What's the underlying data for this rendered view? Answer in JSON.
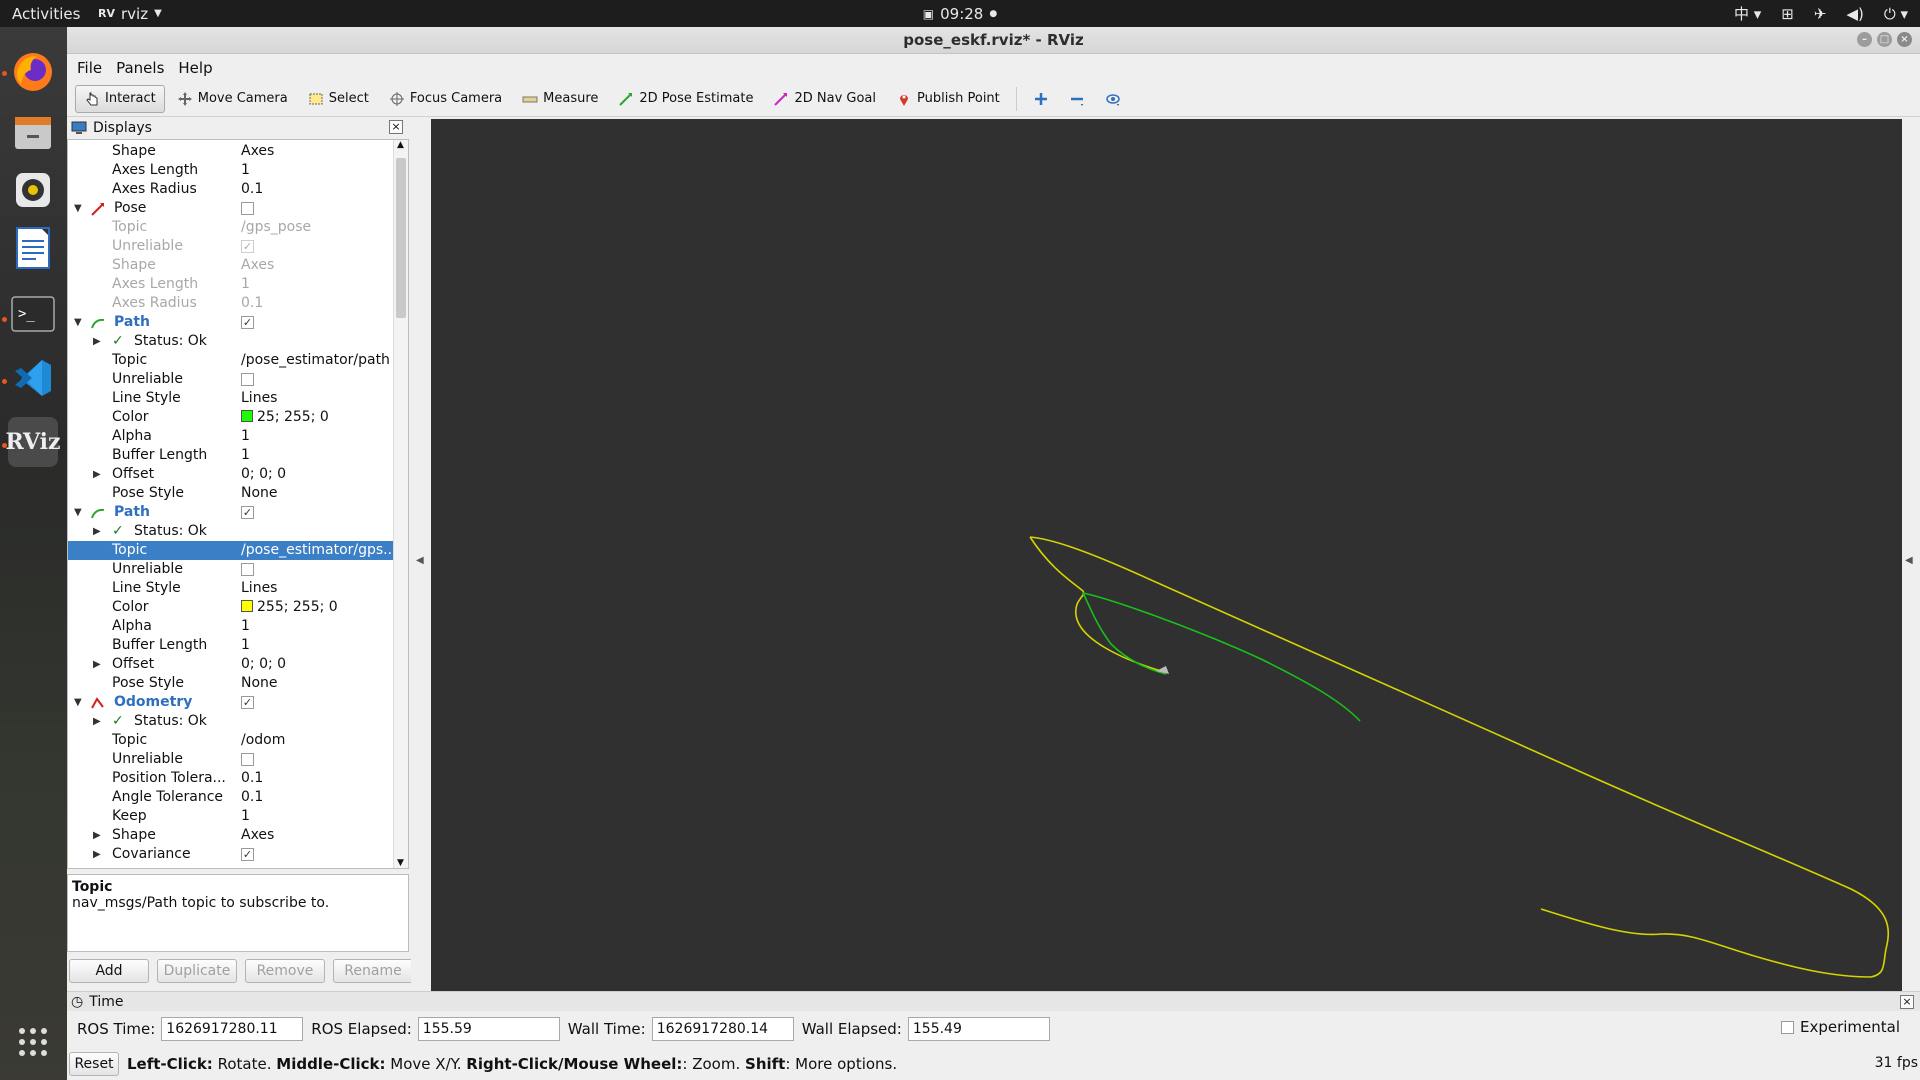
{
  "topbar": {
    "activities": "Activities",
    "app_name": "rviz",
    "clock": "09:28",
    "lang": "中"
  },
  "window": {
    "title": "pose_eskf.rviz* - RViz"
  },
  "menu": [
    {
      "label": "File"
    },
    {
      "label": "Panels"
    },
    {
      "label": "Help"
    }
  ],
  "toolbar": {
    "interact": "Interact",
    "move_camera": "Move Camera",
    "select": "Select",
    "focus_camera": "Focus Camera",
    "measure": "Measure",
    "pose_estimate": "2D Pose Estimate",
    "nav_goal": "2D Nav Goal",
    "publish_point": "Publish Point"
  },
  "displays": {
    "title": "Displays",
    "rows": [
      {
        "name": "Shape",
        "value": "Axes"
      },
      {
        "name": "Axes Length",
        "value": "1"
      },
      {
        "name": "Axes Radius",
        "value": "0.1"
      },
      {
        "name": "Pose"
      },
      {
        "name": "Topic",
        "value": "/gps_pose"
      },
      {
        "name": "Unreliable"
      },
      {
        "name": "Shape",
        "value": "Axes"
      },
      {
        "name": "Axes Length",
        "value": "1"
      },
      {
        "name": "Axes Radius",
        "value": "0.1"
      },
      {
        "name": "Path"
      },
      {
        "name": "Status: Ok"
      },
      {
        "name": "Topic",
        "value": "/pose_estimator/path"
      },
      {
        "name": "Unreliable"
      },
      {
        "name": "Line Style",
        "value": "Lines"
      },
      {
        "name": "Color",
        "value": "25; 255; 0"
      },
      {
        "name": "Alpha",
        "value": "1"
      },
      {
        "name": "Buffer Length",
        "value": "1"
      },
      {
        "name": "Offset",
        "value": "0; 0; 0"
      },
      {
        "name": "Pose Style",
        "value": "None"
      },
      {
        "name": "Path"
      },
      {
        "name": "Status: Ok"
      },
      {
        "name": "Topic",
        "value": "/pose_estimator/gps.."
      },
      {
        "name": "Unreliable"
      },
      {
        "name": "Line Style",
        "value": "Lines"
      },
      {
        "name": "Color",
        "value": "255; 255; 0"
      },
      {
        "name": "Alpha",
        "value": "1"
      },
      {
        "name": "Buffer Length",
        "value": "1"
      },
      {
        "name": "Offset",
        "value": "0; 0; 0"
      },
      {
        "name": "Pose Style",
        "value": "None"
      },
      {
        "name": "Odometry"
      },
      {
        "name": "Status: Ok"
      },
      {
        "name": "Topic",
        "value": "/odom"
      },
      {
        "name": "Unreliable"
      },
      {
        "name": "Position Tolera...",
        "value": "0.1"
      },
      {
        "name": "Angle Tolerance",
        "value": "0.1"
      },
      {
        "name": "Keep",
        "value": "1"
      },
      {
        "name": "Shape",
        "value": "Axes"
      },
      {
        "name": "Covariance"
      }
    ],
    "colors": {
      "path1": "#19ff00",
      "path2": "#ffff00",
      "pose_icon": "#d42020",
      "odom_icon": "#d42020"
    },
    "desc_title": "Topic",
    "desc_text": "nav_msgs/Path topic to subscribe to.",
    "buttons": {
      "add": "Add",
      "duplicate": "Duplicate",
      "remove": "Remove",
      "rename": "Rename"
    }
  },
  "view": {
    "background": "#303030",
    "gps_path_color": "#d4d400",
    "est_path_color": "#19c019"
  },
  "time": {
    "title": "Time",
    "ros_time_label": "ROS Time:",
    "ros_time": "1626917280.11",
    "ros_elapsed_label": "ROS Elapsed:",
    "ros_elapsed": "155.59",
    "wall_time_label": "Wall Time:",
    "wall_time": "1626917280.14",
    "wall_elapsed_label": "Wall Elapsed:",
    "wall_elapsed": "155.49",
    "experimental": "Experimental"
  },
  "status": {
    "reset": "Reset",
    "k1": "Left-Click:",
    "v1": "Rotate.",
    "k2": "Middle-Click:",
    "v2": "Move X/Y.",
    "k3": "Right-Click/Mouse Wheel:",
    "v3": ": Zoom.",
    "k4": "Shift",
    "v4": ": More options.",
    "fps": "31 fps"
  }
}
